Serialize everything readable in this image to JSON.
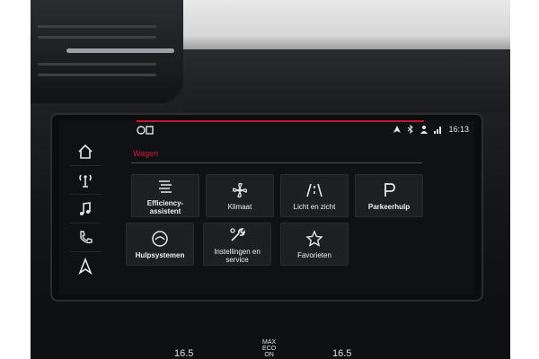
{
  "screen": {
    "title": "Wagen",
    "status": {
      "time": "16:13"
    },
    "sidebar": [
      {
        "name": "home"
      },
      {
        "name": "radio"
      },
      {
        "name": "music"
      },
      {
        "name": "phone"
      },
      {
        "name": "navigation"
      }
    ],
    "tiles": [
      {
        "label": "Efficiency-assistent",
        "icon": "efficiency-icon"
      },
      {
        "label": "Klimaat",
        "icon": "fan-icon"
      },
      {
        "label": "Licht en zicht",
        "icon": "light-icon"
      },
      {
        "label": "Parkeerhulp",
        "icon": "parking-icon"
      },
      {
        "label": "Hulpsystemen",
        "icon": "assist-icon"
      },
      {
        "label": "Instellingen en service",
        "icon": "wrench-icon"
      },
      {
        "label": "Favorieten",
        "icon": "star-icon"
      }
    ]
  },
  "climate": {
    "left_temp": "16.5",
    "right_temp": "16.5",
    "max_eco": "MAX",
    "eco": "ECO",
    "on": "ON"
  },
  "colors": {
    "accent": "#d01a35"
  }
}
